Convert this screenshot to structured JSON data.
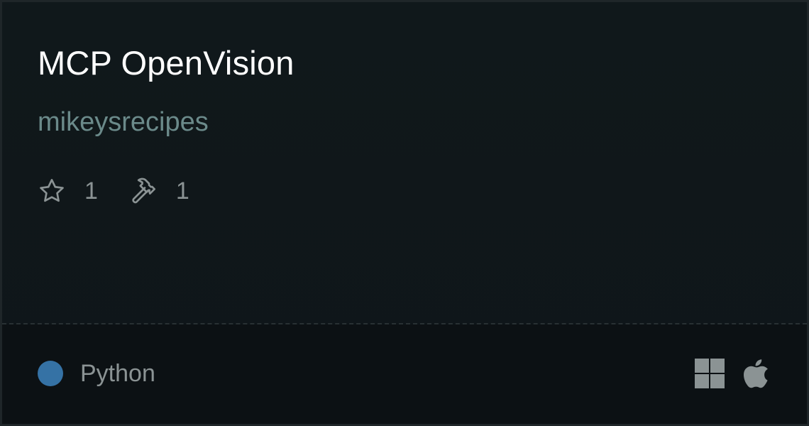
{
  "server": {
    "title": "MCP OpenVision",
    "author": "mikeysrecipes"
  },
  "stats": {
    "stars": "1",
    "tools": "1",
    "star_icon": "star-outline-icon",
    "tools_icon": "hammer-icon"
  },
  "footer": {
    "language": "Python",
    "language_color": "#3572a5",
    "platforms": [
      "windows-icon",
      "apple-icon"
    ]
  }
}
